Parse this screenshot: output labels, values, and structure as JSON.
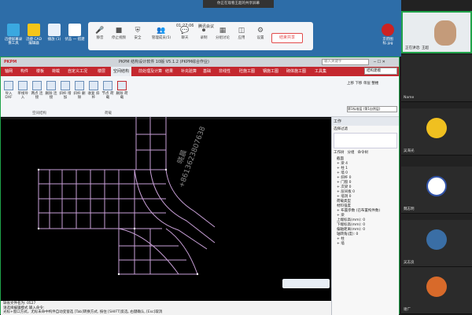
{
  "desktop": {
    "icons": [
      {
        "label": "迅捷屏幕录像工具"
      },
      {
        "label": "迅捷 CAD 编辑器"
      },
      {
        "label": "播放 (1)"
      },
      {
        "label": "伏击 一 搭建"
      },
      {
        "label": "京府图 标.jpg"
      }
    ]
  },
  "meeting": {
    "window_title": "你正在观看王超的共享屏幕",
    "time": "01:27:06",
    "name": "腾讯会议",
    "tools": [
      {
        "label": "静音",
        "icon": "mic-icon"
      },
      {
        "label": "停止视频",
        "icon": "camera-icon"
      },
      {
        "label": "安全",
        "icon": "shield-icon"
      },
      {
        "label": "管理成员(5)",
        "icon": "members-icon"
      },
      {
        "label": "聊天",
        "icon": "chat-icon"
      },
      {
        "label": "录制",
        "icon": "record-icon"
      },
      {
        "label": "分组讨论",
        "icon": "group-icon"
      },
      {
        "label": "应用",
        "icon": "apps-icon"
      },
      {
        "label": "设置",
        "icon": "gear-icon"
      }
    ],
    "end_button": "结束共享"
  },
  "app": {
    "title": "PKPM 结构设计软件 10版 V5.1.2 (PKPM综合作业)",
    "search_placeholder": "输入关键字",
    "menu": [
      "轴网",
      "构件",
      "楼板",
      "荷载",
      "自定义工况",
      "楼层",
      "空间结构",
      "前处理及计算",
      "结果",
      "补充验算",
      "基础",
      "非线性",
      "砼施工图",
      "钢施工图",
      "砌体施工图",
      "工具集"
    ],
    "active_menu": "空间结构",
    "ribbon": [
      {
        "label": "导入 DXF"
      },
      {
        "label": "单线导入"
      },
      {
        "label": "两点 连接"
      },
      {
        "label": "删除 连接"
      },
      {
        "label": "斜杆 增加"
      },
      {
        "label": "斜杆 删除"
      },
      {
        "label": "收复 斜杆"
      },
      {
        "label": "节点 荷载"
      },
      {
        "label": "删除 荷载"
      }
    ],
    "ribbon_groups": [
      "空间结构",
      "荷载"
    ],
    "floor_group": [
      "上移",
      "下移",
      "单层",
      "整楼",
      "第1标准层 (第1自然层)"
    ],
    "right_combo": "结构建模",
    "status_lines": [
      "缺省文件名为: 0527",
      "请选择编辑模式 输入命令:",
      "光标+窗口方式，尤标未命中构件自动变窗选 [Tab]转换方式, 按住 [SHIFT]反选, 右键确认, [Esc]取消"
    ]
  },
  "panel": {
    "title": "工作",
    "filter": "选择过滤",
    "tabs": [
      "工作树",
      "分组",
      "命令树"
    ],
    "tree": [
      "截面",
      "+ 梁 4",
      "+ 柱 1",
      "+ 墙 0",
      "+ 斜杆 0",
      "+ 门窗 0",
      "+ 次梁 0",
      "+ 层间板 0",
      "+ 墙洞 0",
      "荷载类型",
      "材料强度",
      "+ 布置参数 (已布置构件数)",
      "+ 梁",
      "  上端标高(mm): 0",
      "  下端标高(mm): 0",
      "  偏轴距离(mm): 0",
      "  轴转角(度): 0",
      "+ 柱",
      "+ 墙"
    ]
  },
  "participants": [
    {
      "name": "正在讲话: 王超"
    },
    {
      "name": "Name"
    },
    {
      "name": "吴海光"
    },
    {
      "name": "魏志明"
    },
    {
      "name": "吴志良"
    },
    {
      "name": "谢广"
    }
  ],
  "watermark": {
    "line1": "晓晨",
    "line2": "+8613623807638"
  },
  "colors": {
    "brand_red": "#c4282f",
    "cad_beam": "#c9a0d8",
    "meeting_border": "#20a34a"
  }
}
